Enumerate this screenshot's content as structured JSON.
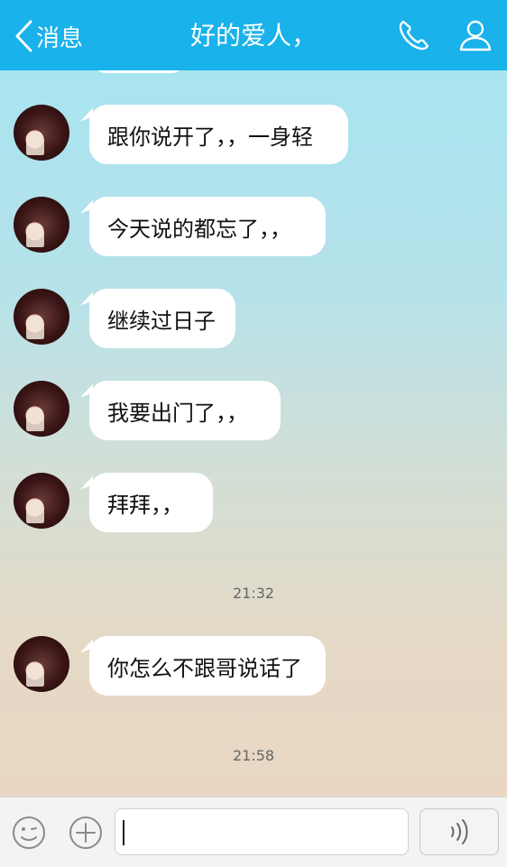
{
  "header": {
    "back_label": "消息",
    "title": "好的爱人，",
    "phone_icon": "phone-icon",
    "profile_icon": "user-icon",
    "bg_color": "#19b2ea"
  },
  "messages": [
    {
      "text": "跟你说开了，，一身轻"
    },
    {
      "text": "今天说的都忘了，，"
    },
    {
      "text": "继续过日子"
    },
    {
      "text": "我要出门了，，"
    },
    {
      "text": "拜拜，，"
    },
    {
      "text": "你怎么不跟哥说话了"
    }
  ],
  "timestamps": [
    "21:32",
    "21:58"
  ],
  "input": {
    "value": "",
    "emoji_icon": "emoji-icon",
    "plus_icon": "plus-icon",
    "voice_icon": "voice-icon"
  }
}
